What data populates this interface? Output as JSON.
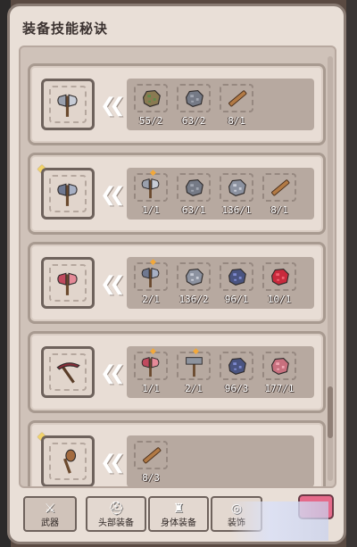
{
  "window": {
    "title": "装备技能秘诀"
  },
  "recipes": [
    {
      "starred": false,
      "target_icon": "battle-axe-grey-icon",
      "materials": [
        {
          "icon": "mossy-ore-icon",
          "count": "55/2",
          "starred": false
        },
        {
          "icon": "iron-ore-icon",
          "count": "63/2",
          "starred": false
        },
        {
          "icon": "wood-stick-icon",
          "count": "8/1",
          "starred": false
        }
      ]
    },
    {
      "starred": true,
      "target_icon": "battle-axe-steel-icon",
      "materials": [
        {
          "icon": "battle-axe-grey-icon",
          "count": "1/1",
          "starred": true
        },
        {
          "icon": "iron-ore-icon",
          "count": "63/1",
          "starred": false
        },
        {
          "icon": "silver-ore-icon",
          "count": "136/1",
          "starred": false
        },
        {
          "icon": "wood-stick-icon",
          "count": "8/1",
          "starred": false
        }
      ]
    },
    {
      "starred": false,
      "target_icon": "battle-axe-red-icon",
      "materials": [
        {
          "icon": "battle-axe-steel-icon",
          "count": "2/1",
          "starred": true
        },
        {
          "icon": "silver-ore-icon",
          "count": "136/2",
          "starred": false
        },
        {
          "icon": "sapphire-ore-icon",
          "count": "96/1",
          "starred": false
        },
        {
          "icon": "ruby-ore-icon",
          "count": "10/1",
          "starred": false
        }
      ]
    },
    {
      "starred": false,
      "target_icon": "pickaxe-icon",
      "materials": [
        {
          "icon": "battle-axe-red-icon",
          "count": "1/1",
          "starred": true
        },
        {
          "icon": "hammer-icon",
          "count": "2/1",
          "starred": true
        },
        {
          "icon": "sapphire-ore-icon",
          "count": "96/3",
          "starred": false
        },
        {
          "icon": "pink-ore-icon",
          "count": "177/1",
          "starred": false
        }
      ]
    },
    {
      "starred": true,
      "target_icon": "wooden-club-icon",
      "materials": [
        {
          "icon": "wood-stick-icon",
          "count": "8/3",
          "starred": false
        }
      ]
    }
  ],
  "tabs": [
    {
      "label": "武器",
      "icon": "weapon-tab-icon",
      "active": true
    },
    {
      "label": "头部装备",
      "icon": "helmet-tab-icon",
      "active": false
    },
    {
      "label": "身体装备",
      "icon": "armor-tab-icon",
      "active": false
    },
    {
      "label": "装饰",
      "icon": "accessory-tab-icon",
      "active": false
    }
  ],
  "colors": {
    "panel_bg": "#e9dfd7",
    "row_bg": "#e8ddd5",
    "material_bg": "#b7a9a0",
    "pink_button": "#e56a8a"
  }
}
